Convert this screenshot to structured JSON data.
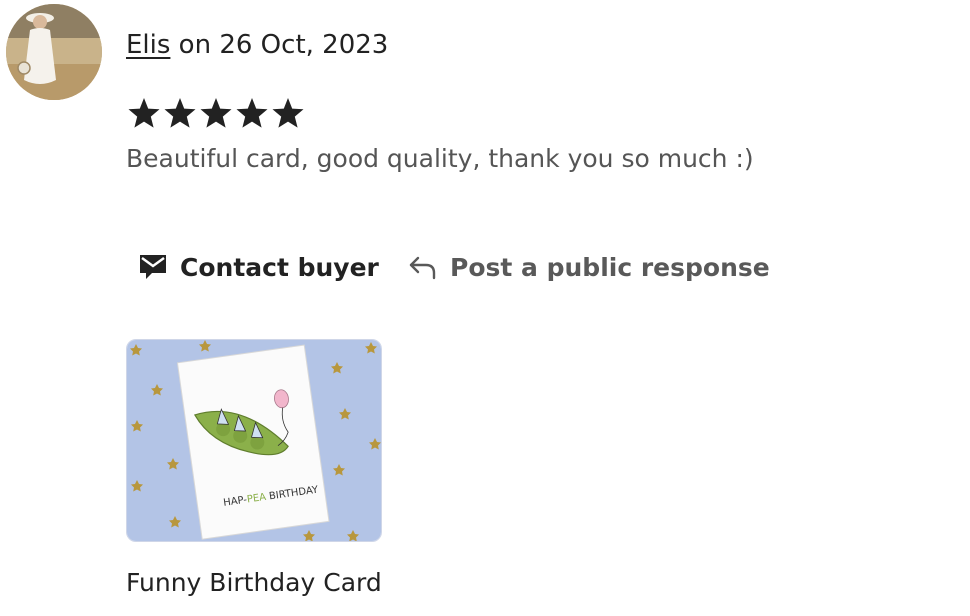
{
  "review": {
    "reviewer_name": "Elis",
    "date_text": " on 26 Oct, 2023",
    "rating": 5,
    "rating_max": 5,
    "text": "Beautiful card, good quality, thank you so much :)"
  },
  "actions": {
    "contact_label": "Contact buyer",
    "contact_icon": "envelope-icon",
    "respond_label": "Post a public response",
    "respond_icon": "reply-arrow-icon"
  },
  "product": {
    "title": "Funny Birthday Card",
    "card_text_part1": "HAP-",
    "card_text_pea": "PEA",
    "card_text_part2": " BIRTHDAY"
  },
  "colors": {
    "star": "#222222",
    "thumb_background": "#b3c4e6",
    "pod_green": "#8bb04a"
  }
}
